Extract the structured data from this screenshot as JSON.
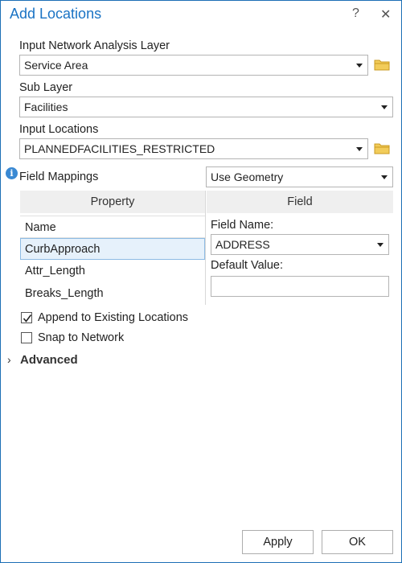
{
  "window": {
    "title": "Add Locations",
    "help_label": "?",
    "close_label": "✕"
  },
  "input_network_layer": {
    "label": "Input Network Analysis Layer",
    "value": "Service Area"
  },
  "sub_layer": {
    "label": "Sub Layer",
    "value": "Facilities"
  },
  "input_locations": {
    "label": "Input Locations",
    "value": "PLANNEDFACILITIES_RESTRICTED"
  },
  "field_mappings": {
    "label": "Field Mappings",
    "value": "Use Geometry",
    "info_icon": "i",
    "property_header": "Property",
    "field_header": "Field",
    "name_header": "Name",
    "rows": [
      "CurbApproach",
      "Attr_Length",
      "Breaks_Length"
    ],
    "selected_row": 0,
    "field_name_label": "Field Name:",
    "field_name_value": "ADDRESS",
    "default_value_label": "Default Value:",
    "default_value": ""
  },
  "options": {
    "append_label": "Append to Existing Locations",
    "append_checked": true,
    "snap_label": "Snap to Network",
    "snap_checked": false
  },
  "advanced": {
    "label": "Advanced",
    "chevron": "›"
  },
  "buttons": {
    "apply": "Apply",
    "ok": "OK"
  },
  "colors": {
    "title": "#1a73c4",
    "border": "#1c6fb5",
    "folder": "#e8b93c",
    "selection": "#e6f1fb"
  }
}
